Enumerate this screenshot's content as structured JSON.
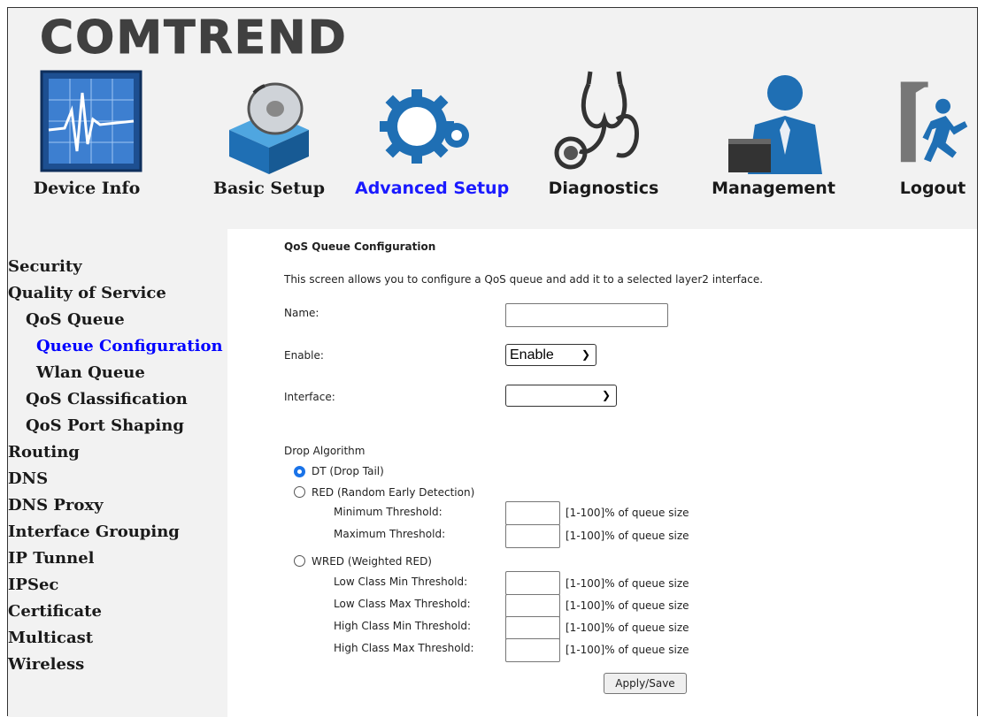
{
  "brand": {
    "logo_text": "COMTREND"
  },
  "nav": [
    {
      "label": "Device Info",
      "icon": "device-info-icon"
    },
    {
      "label": "Basic Setup",
      "icon": "basic-setup-icon"
    },
    {
      "label": "Advanced Setup",
      "icon": "advanced-setup-icon",
      "active": true
    },
    {
      "label": "Diagnostics",
      "icon": "stethoscope-icon"
    },
    {
      "label": "Management",
      "icon": "management-icon"
    },
    {
      "label": "Logout",
      "icon": "logout-icon"
    }
  ],
  "sidebar": {
    "items": [
      {
        "label": "Security"
      },
      {
        "label": "Quality of Service"
      },
      {
        "label": "QoS Queue"
      },
      {
        "label": "Queue Configuration",
        "active": true
      },
      {
        "label": "Wlan Queue"
      },
      {
        "label": "QoS Classification"
      },
      {
        "label": "QoS Port Shaping"
      },
      {
        "label": "Routing"
      },
      {
        "label": "DNS"
      },
      {
        "label": "DNS Proxy"
      },
      {
        "label": "Interface Grouping"
      },
      {
        "label": "IP Tunnel"
      },
      {
        "label": "IPSec"
      },
      {
        "label": "Certificate"
      },
      {
        "label": "Multicast"
      },
      {
        "label": "Wireless"
      }
    ]
  },
  "form": {
    "title": "QoS Queue Configuration",
    "description": "This screen allows you to configure a QoS queue and add it to a selected layer2 interface.",
    "name_label": "Name:",
    "name_value": "",
    "enable_label": "Enable:",
    "enable_value": "Enable",
    "interface_label": "Interface:",
    "interface_value": "",
    "drop_algorithm_label": "Drop Algorithm",
    "dt_label": "DT (Drop Tail)",
    "red_label": "RED (Random Early Detection)",
    "min_threshold_label": "Minimum Threshold:",
    "max_threshold_label": "Maximum Threshold:",
    "wred_label": "WRED (Weighted RED)",
    "low_min_label": "Low Class Min Threshold:",
    "low_max_label": "Low Class Max Threshold:",
    "high_min_label": "High Class Min Threshold:",
    "high_max_label": "High Class Max Threshold:",
    "unit_hint": "[1-100]% of queue size",
    "apply_label": "Apply/Save",
    "selected_algorithm": "DT"
  },
  "colors": {
    "active_link": "#0000ff",
    "radio_selected": "#1a73e8"
  }
}
